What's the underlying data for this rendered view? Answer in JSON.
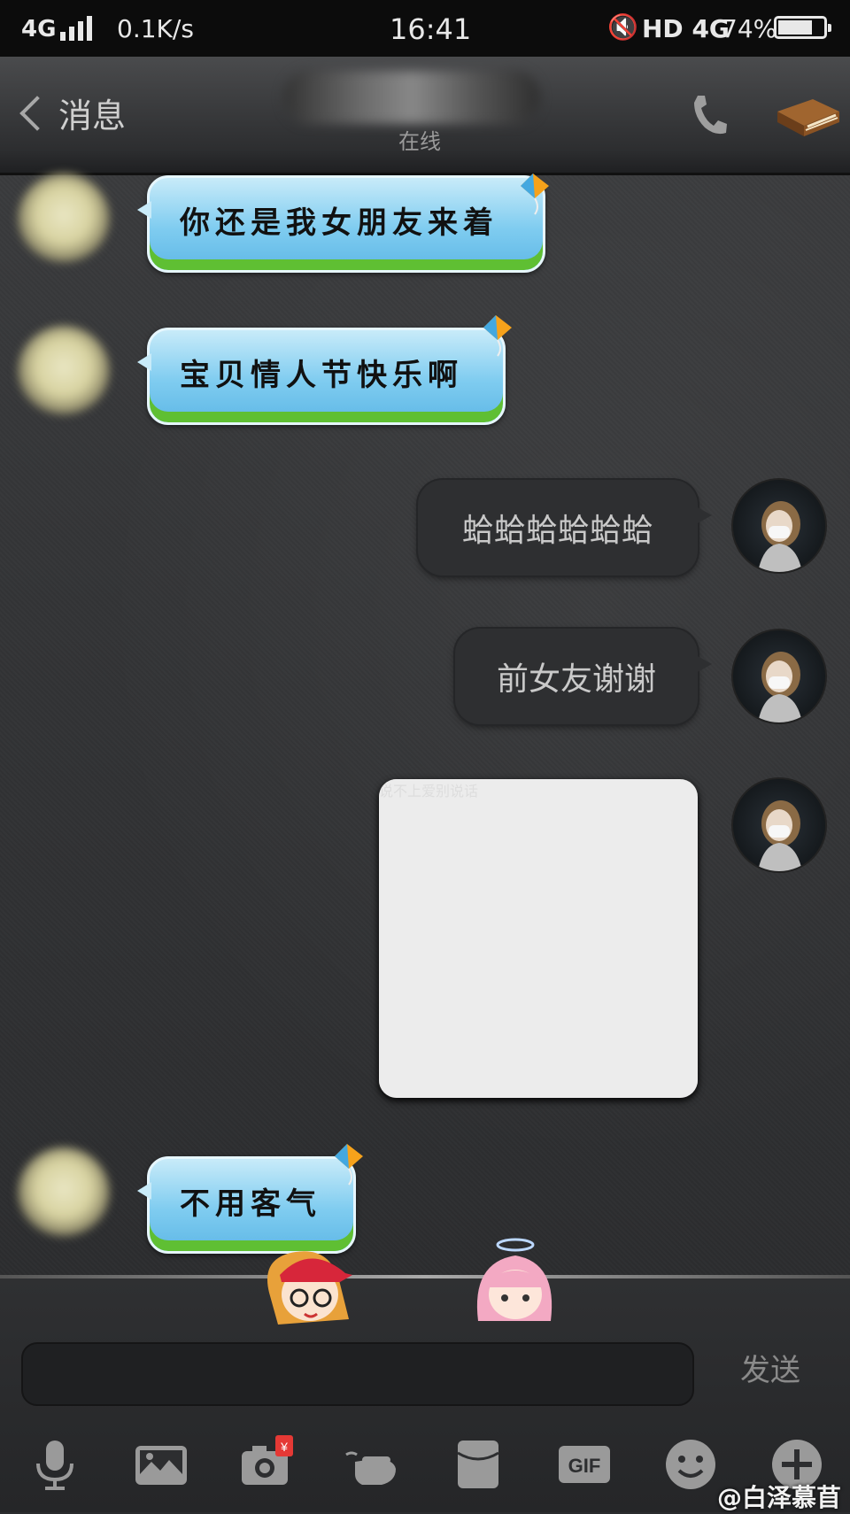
{
  "status_bar": {
    "network": "4G",
    "speed": "0.1K/s",
    "time": "16:41",
    "hd": "HD",
    "network2": "4G",
    "battery": "74%",
    "battery_level": 0.74
  },
  "header": {
    "back_label": "消息",
    "contact_status": "在线"
  },
  "messages": [
    {
      "side": "in",
      "text": "你还是我女朋友来着"
    },
    {
      "side": "in",
      "text": "宝贝情人节快乐啊"
    },
    {
      "side": "out",
      "text": "蛤蛤蛤蛤蛤蛤"
    },
    {
      "side": "out",
      "text": "前女友谢谢"
    },
    {
      "side": "out",
      "type": "sticker",
      "caption": "说不上爱别说话"
    },
    {
      "side": "in",
      "text": "不用客气"
    }
  ],
  "input": {
    "value": "",
    "send_label": "发送"
  },
  "toolbar": {
    "items": [
      "microphone-icon",
      "image-icon",
      "camera-icon",
      "poke-icon",
      "red-packet-icon",
      "gif-icon",
      "emoji-icon",
      "plus-icon"
    ],
    "camera_badge": "¥",
    "gif_label": "GIF"
  },
  "watermark": "@白泽慕苜"
}
